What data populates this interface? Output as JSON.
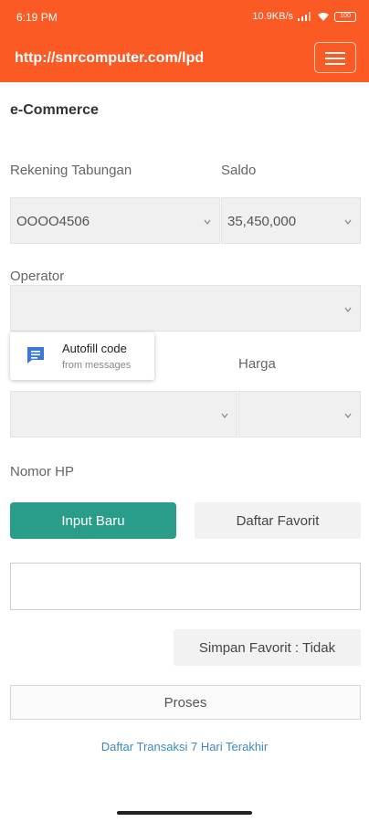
{
  "status": {
    "time": "6:19 PM",
    "net_speed": "10.9KB/s",
    "battery": "100"
  },
  "appbar": {
    "url": "http://snrcomputer.com/lpd",
    "menu_icon": "hamburger-icon",
    "color": "#fc5a24"
  },
  "page": {
    "title": "e-Commerce"
  },
  "form": {
    "rekening_label": "Rekening Tabungan",
    "rekening_value": "OOOO4506",
    "saldo_label": "Saldo",
    "saldo_value": "35,450,000",
    "operator_label": "Operator",
    "operator_value": "",
    "harga_label": "Harga",
    "nomor_hp_label": "Nomor HP"
  },
  "autofill": {
    "title": "Autofill code",
    "subtitle": "from messages",
    "icon": "message-icon"
  },
  "buttons": {
    "input_baru": "Input Baru",
    "daftar_favorit": "Daftar Favorit",
    "simpan_favorit": "Simpan Favorit : Tidak",
    "proses": "Proses"
  },
  "links": {
    "daftar_transaksi": "Daftar Transaksi 7 Hari Terakhir"
  },
  "colors": {
    "accent": "#2a9d8a",
    "link": "#3d8bbd"
  }
}
